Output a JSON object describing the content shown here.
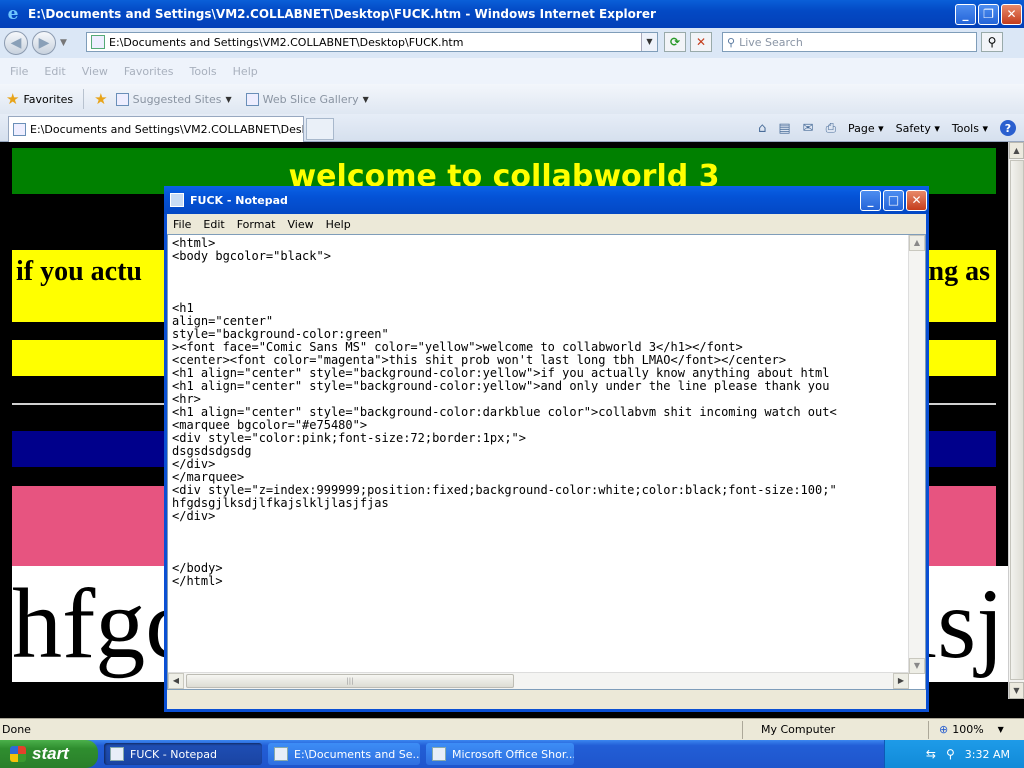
{
  "browser": {
    "title": "E:\\Documents and Settings\\VM2.COLLABNET\\Desktop\\FUCK.htm - Windows Internet Explorer",
    "address": "E:\\Documents and Settings\\VM2.COLLABNET\\Desktop\\FUCK.htm",
    "search_placeholder": "Live Search",
    "menu": [
      "File",
      "Edit",
      "View",
      "Favorites",
      "Tools",
      "Help"
    ],
    "favorites_label": "Favorites",
    "fav_links": [
      "Suggested Sites",
      "Web Slice Gallery"
    ],
    "tab_label": "E:\\Documents and Settings\\VM2.COLLABNET\\Desktop...",
    "commands": {
      "page": "Page",
      "safety": "Safety",
      "tools": "Tools"
    },
    "status_text": "Done",
    "zone": "My Computer",
    "zoom": "100%"
  },
  "page": {
    "h1_green": "welcome to collabworld 3",
    "h1_yellow_left": "if you actu",
    "h1_yellow_right": "ng as",
    "big_text_left": "hfgc",
    "big_text_right": "lsj",
    "colors": {
      "green": "#008000",
      "yellow": "#ffff00",
      "darkblue": "#00008b",
      "marquee": "#e75480"
    }
  },
  "notepad": {
    "title": "FUCK - Notepad",
    "menu": [
      "File",
      "Edit",
      "Format",
      "View",
      "Help"
    ],
    "content": "<html>\n<body bgcolor=\"black\">\n\n\n\n<h1\nalign=\"center\"\nstyle=\"background-color:green\"\n><font face=\"Comic Sans MS\" color=\"yellow\">welcome to collabworld 3</h1></font>\n<center><font color=\"magenta\">this shit prob won't last long tbh LMAO</font></center>\n<h1 align=\"center\" style=\"background-color:yellow\">if you actually know anything about html \n<h1 align=\"center\" style=\"background-color:yellow\">and only under the line please thank you\n<hr>\n<h1 align=\"center\" style=\"background-color:darkblue color\">collabvm shit incoming watch out<\n<marquee bgcolor=\"#e75480\">\n<div style=\"color:pink;font-size:72;border:1px;\">\ndsgsdsdgsdg\n</div>\n</marquee>\n<div style=\"z=index:999999;position:fixed;background-color:white;color:black;font-size:100;\"\nhfgdsgjlksdjlfkajslkljlasjfjas\n</div>\n\n\n\n</body>\n</html>"
  },
  "taskbar": {
    "start_label": "start",
    "tasks": [
      "FUCK - Notepad",
      "E:\\Documents and Se...",
      "Microsoft Office Shor..."
    ],
    "clock": "3:32 AM"
  }
}
